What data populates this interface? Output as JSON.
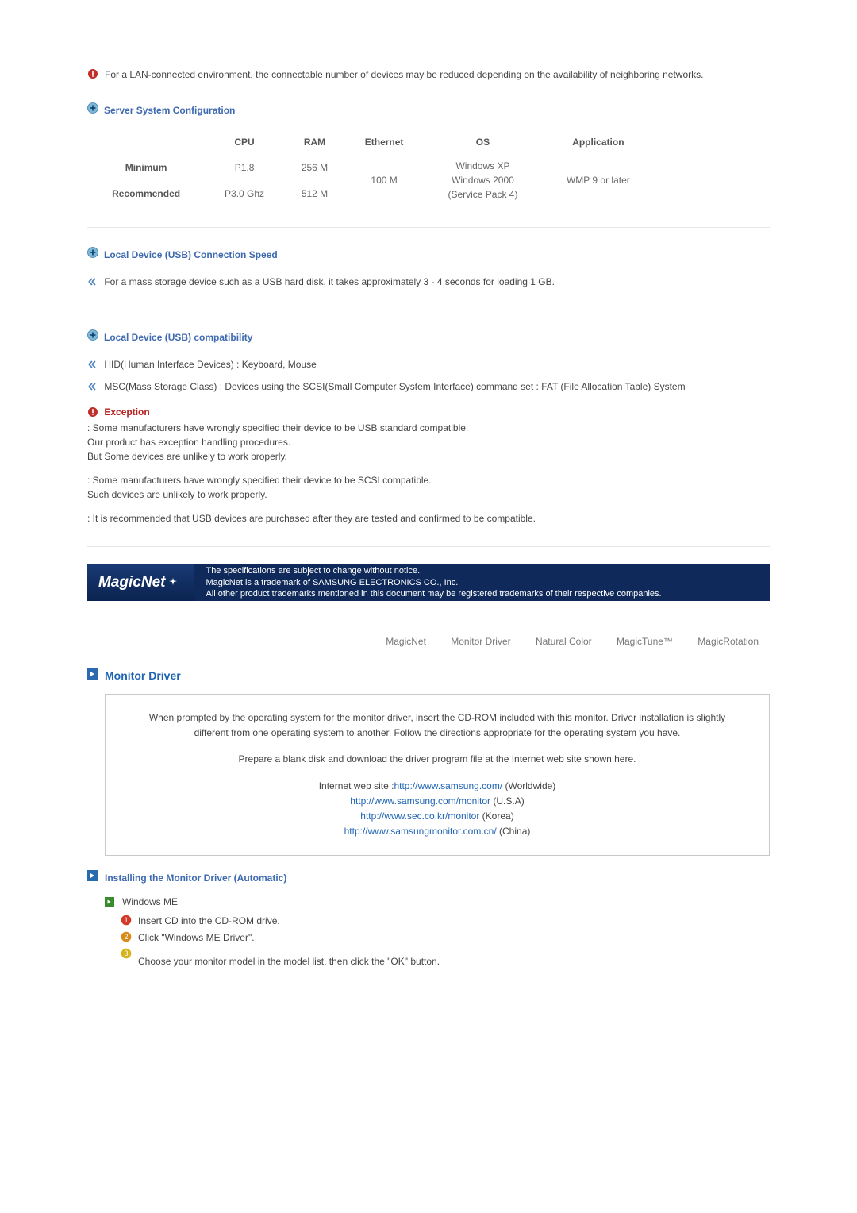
{
  "lan_note": "For a LAN-connected environment, the connectable number of devices may be reduced depending on the availability of neighboring networks.",
  "sections": {
    "server_config": {
      "title": "Server System Configuration",
      "headers": {
        "cpu": "CPU",
        "ram": "RAM",
        "ethernet": "Ethernet",
        "os": "OS",
        "application": "Application"
      },
      "rows": {
        "min_label": "Minimum",
        "rec_label": "Recommended",
        "min": {
          "cpu": "P1.8",
          "ram": "256 M"
        },
        "rec": {
          "cpu": "P3.0 Ghz",
          "ram": "512 M"
        },
        "shared": {
          "ethernet": "100 M",
          "os_line1": "Windows XP",
          "os_line2": "Windows 2000",
          "os_line3": "(Service Pack 4)",
          "application": "WMP 9 or later"
        }
      }
    },
    "usb_speed": {
      "title": "Local Device (USB) Connection Speed",
      "body": "For a mass storage device such as a USB hard disk, it takes approximately 3 - 4 seconds for loading 1 GB."
    },
    "usb_compat": {
      "title": "Local Device (USB) compatibility",
      "hid": "HID(Human Interface Devices) : Keyboard, Mouse",
      "msc": "MSC(Mass Storage Class) : Devices using the SCSI(Small Computer System Interface) command set : FAT (File Allocation Table) System",
      "exception_title": "Exception",
      "exc1": ": Some manufacturers have wrongly specified their device to be USB standard compatible.\n  Our product has exception handling procedures.\n  But Some devices are unlikely to work properly.",
      "exc2": ": Some manufacturers have wrongly specified their device to be SCSI compatible.\n  Such devices are unlikely to work properly.",
      "exc3": ": It is recommended that USB devices are purchased after they are tested and confirmed to be compatible."
    }
  },
  "banner": {
    "logo": "MagicNet",
    "line1": "The specifications are subject to change without notice.",
    "line2": "MagicNet is a trademark of SAMSUNG ELECTRONICS CO., Inc.",
    "line3": "All other product trademarks mentioned in this document may be registered trademarks of their respective companies."
  },
  "tabs": {
    "t1": "MagicNet",
    "t2": "Monitor Driver",
    "t3": "Natural Color",
    "t4": "MagicTune™",
    "t5": "MagicRotation"
  },
  "monitor_driver": {
    "title": "Monitor Driver",
    "box": {
      "intro": "When prompted by the operating system for the monitor driver, insert the CD-ROM included with this monitor. Driver installation is slightly different from one operating system to another. Follow the directions appropriate for the operating system you have.",
      "prepare": "Prepare a blank disk and download the driver program file at the Internet web site shown here.",
      "site_label": "Internet web site :",
      "links": {
        "ww": "http://www.samsung.com/",
        "ww_tag": " (Worldwide)",
        "us": "http://www.samsung.com/monitor",
        "us_tag": " (U.S.A)",
        "kr": "http://www.sec.co.kr/monitor",
        "kr_tag": " (Korea)",
        "cn": "http://www.samsungmonitor.com.cn/",
        "cn_tag": " (China)"
      }
    },
    "install_auto_title": "Installing the Monitor Driver (Automatic)",
    "os_winme": "Windows ME",
    "steps": {
      "s1": "Insert CD into the CD-ROM drive.",
      "s2": "Click \"Windows ME Driver\".",
      "s3_body": "Choose your monitor model in the model list, then click the \"OK\" button."
    }
  }
}
